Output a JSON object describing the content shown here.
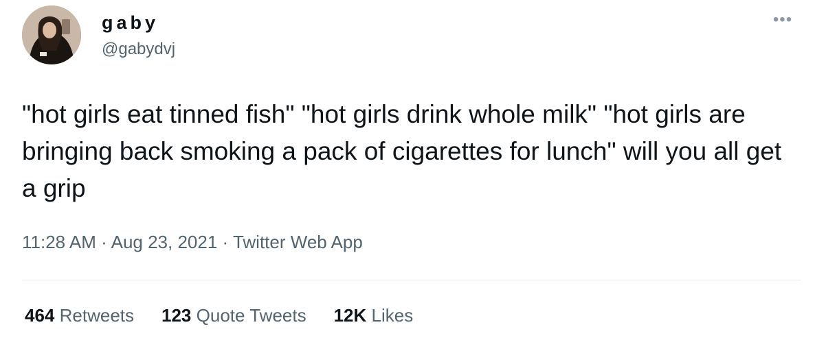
{
  "tweet": {
    "display_name": "gaby",
    "handle": "@gabydvj",
    "text": "\"hot girls eat tinned fish\" \"hot girls drink whole milk\" \"hot girls are bringing back smoking a pack of cigarettes for lunch\" will you all get a grip",
    "time": "11:28 AM",
    "date": "Aug 23, 2021",
    "source": "Twitter Web App",
    "separator": " · ",
    "more_icon": "more-horizontal-icon"
  },
  "stats": [
    {
      "count": "464",
      "label": "Retweets"
    },
    {
      "count": "123",
      "label": "Quote Tweets"
    },
    {
      "count": "12K",
      "label": "Likes"
    }
  ],
  "colors": {
    "text": "#0f1419",
    "secondary": "#536471",
    "divider": "#e6ecf0"
  }
}
